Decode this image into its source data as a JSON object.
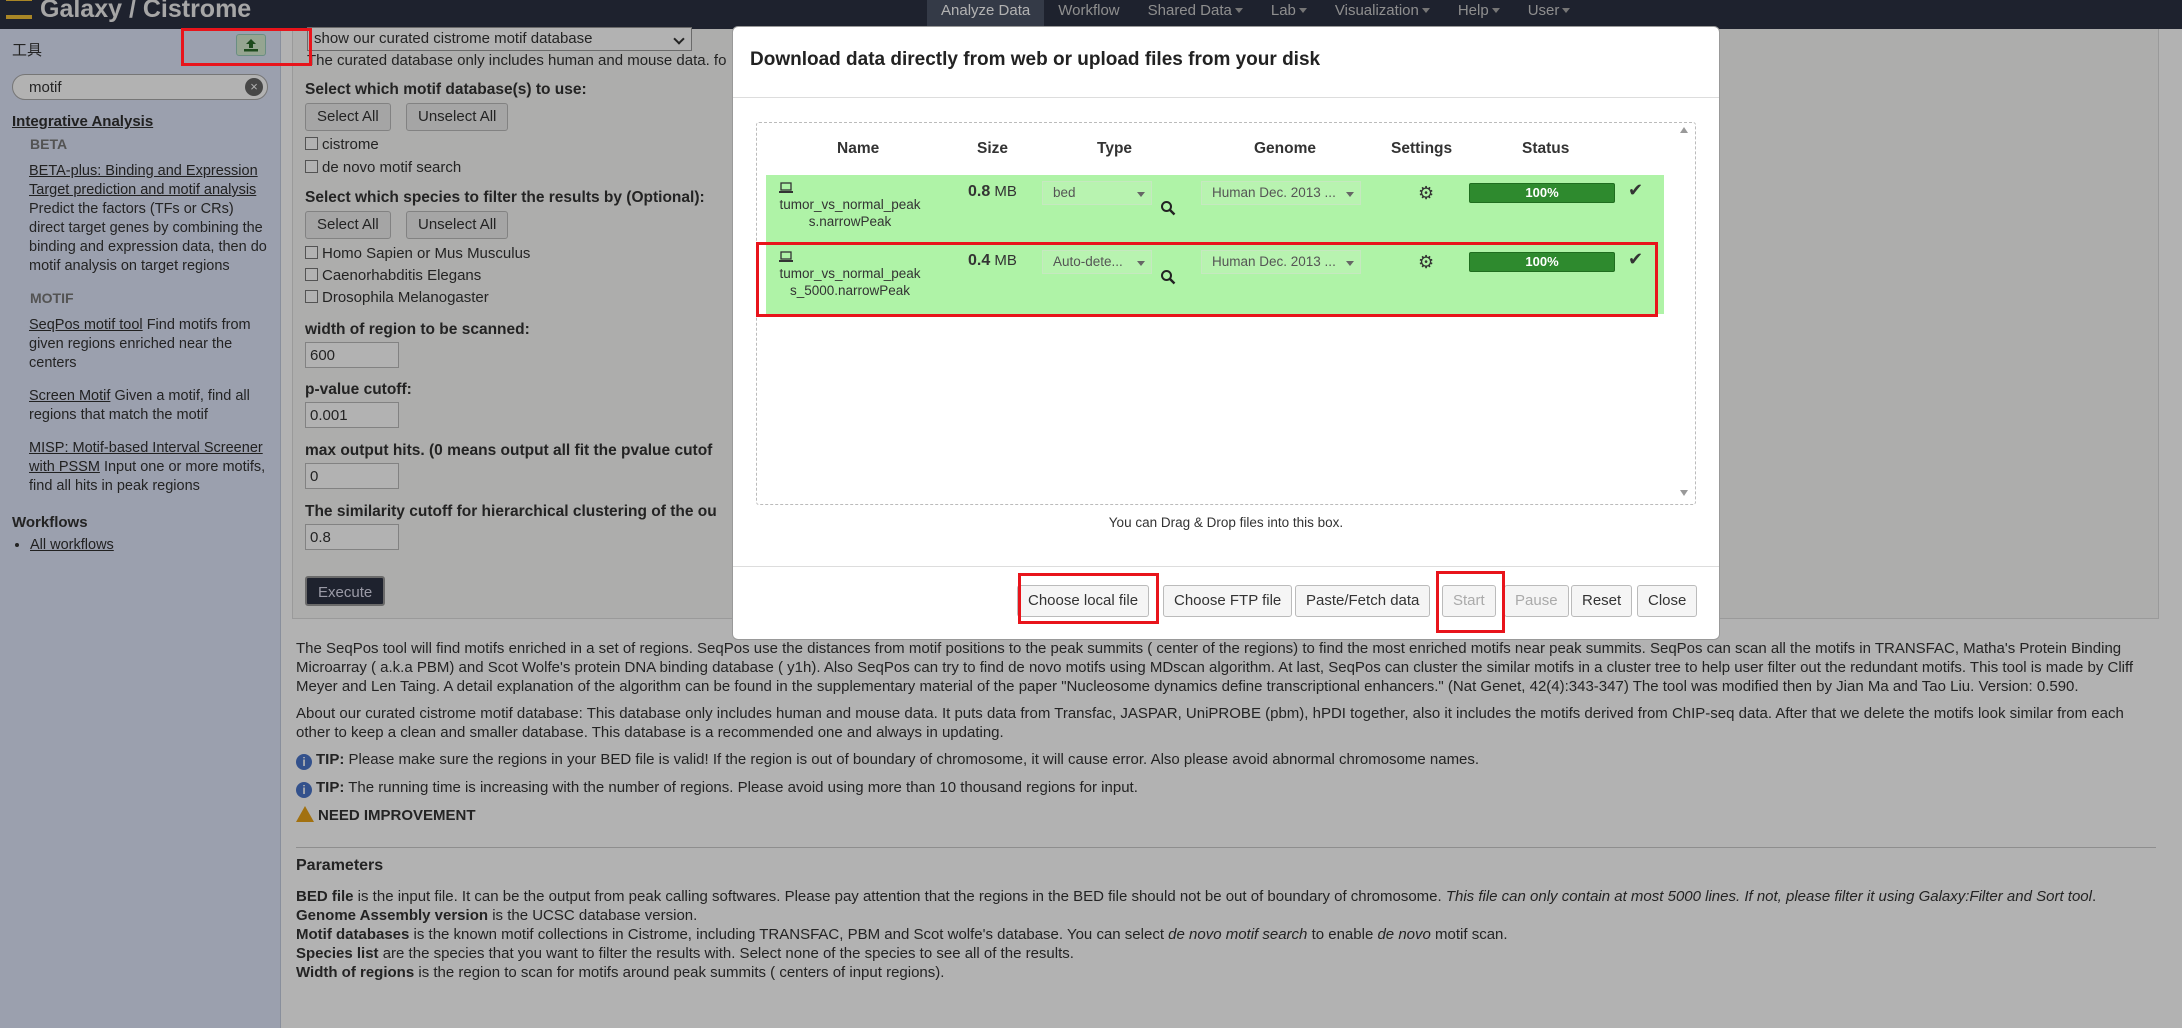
{
  "header": {
    "brand": "Galaxy / Cistrome",
    "nav": [
      {
        "label": "Analyze Data",
        "active": true,
        "dropdown": false
      },
      {
        "label": "Workflow",
        "active": false,
        "dropdown": false
      },
      {
        "label": "Shared Data",
        "active": false,
        "dropdown": true
      },
      {
        "label": "Lab",
        "active": false,
        "dropdown": true
      },
      {
        "label": "Visualization",
        "active": false,
        "dropdown": true
      },
      {
        "label": "Help",
        "active": false,
        "dropdown": true
      },
      {
        "label": "User",
        "active": false,
        "dropdown": true
      }
    ]
  },
  "tools_panel": {
    "title": "工具",
    "upload_icon": "upload-icon",
    "search_value": "motif",
    "section_title": "Integrative Analysis",
    "categories": [
      {
        "name": "BETA",
        "tools": [
          {
            "link": "BETA-plus: Binding and Expression Target prediction and motif analysis",
            "desc": "Predict the factors (TFs or CRs) direct target genes by combining the binding and expression data, then do motif analysis on target regions"
          }
        ]
      },
      {
        "name": "MOTIF",
        "tools": [
          {
            "link": "SeqPos motif tool",
            "desc": "Find motifs from given regions enriched near the centers"
          },
          {
            "link": "Screen Motif",
            "desc": "Given a motif, find all regions that match the motif"
          },
          {
            "link": "MISP: Motif-based Interval Screener with PSSM",
            "desc": "Input one or more motifs, find all hits in peak regions"
          }
        ]
      }
    ],
    "workflows_title": "Workflows",
    "workflows_link": "All workflows"
  },
  "form": {
    "db_select_value": "show our curated cistrome motif database",
    "db_note": "The curated database only includes human and mouse data. fo",
    "db_label": "Select which motif database(s) to use:",
    "select_all": "Select All",
    "unselect_all": "Unselect All",
    "db_options": [
      "cistrome",
      "de novo motif search"
    ],
    "species_label": "Select which species to filter the results by (Optional):",
    "species_options": [
      "Homo Sapien or Mus Musculus",
      "Caenorhabditis Elegans",
      "Drosophila Melanogaster"
    ],
    "width_label": "width of region to be scanned:",
    "width_value": "600",
    "pvalue_label": "p-value cutoff:",
    "pvalue_value": "0.001",
    "maxhits_label": "max output hits. (0 means output all fit the pvalue cutof",
    "maxhits_value": "0",
    "similarity_label": "The similarity cutoff for hierarchical clustering of the ou",
    "similarity_value": "0.8",
    "execute_label": "Execute"
  },
  "help": {
    "para1": "The SeqPos tool will find motifs enriched in a set of regions. SeqPos use the distances from motif positions to the peak summits ( center of the regions) to find the most enriched motifs near peak summits. SeqPos can scan all the motifs in TRANSFAC, Matha's Protein Binding Microarray ( a.k.a PBM) and Scot Wolfe's protein DNA binding database ( y1h). Also SeqPos can try to find de novo motifs using MDscan algorithm. At last, SeqPos can cluster the similar motifs in a cluster tree to help user filter out the redundant motifs. This tool is made by Cliff Meyer and Len Taing. A detail explanation of the algorithm can be found in the supplementary material of the paper \"Nucleosome dynamics define transcriptional enhancers.\" (Nat Genet, 42(4):343-347) The tool was modified then by Jian Ma and Tao Liu. Version: 0.590.",
    "para2": "About our curated cistrome motif database: This database only includes human and mouse data. It puts data from Transfac, JASPAR, UniPROBE (pbm), hPDI together, also it includes the motifs derived from ChIP-seq data. After that we delete the motifs look similar from each other to keep a clean and smaller database. This database is a recommended one and always in updating.",
    "tip_label": "TIP:",
    "tip1": "Please make sure the regions in your BED file is valid! If the region is out of boundary of chromosome, it will cause error. Also please avoid abnormal chromosome names.",
    "tip2": "The running time is increasing with the number of regions. Please avoid using more than 10 thousand regions for input.",
    "need_improvement": "NEED IMPROVEMENT",
    "params_title": "Parameters",
    "p_bed_term": "BED file",
    "p_bed": " is the input file. It can be the output from peak calling softwares. Please pay attention that the regions in the BED file should not be out of boundary of chromosome. ",
    "p_bed_italic": "This file can only contain at most 5000 lines. If not, please filter it using Galaxy:Filter and Sort tool",
    "p_genome_term": "Genome Assembly version",
    "p_genome": " is the UCSC database version.",
    "p_motif_term": "Motif databases",
    "p_motif_a": " is the known motif collections in Cistrome, including TRANSFAC, PBM and Scot wolfe's database. You can select ",
    "p_motif_i1": "de novo motif search",
    "p_motif_b": " to enable ",
    "p_motif_i2": "de novo",
    "p_motif_c": " motif scan.",
    "p_species_term": "Species list",
    "p_species": " are the species that you want to filter the results with. Select none of the species to see all of the results.",
    "p_width_term": "Width of regions",
    "p_width": " is the region to scan for motifs around peak summits ( centers of input regions)."
  },
  "upload_dialog": {
    "title": "Download data directly from web or upload files from your disk",
    "columns": [
      "Name",
      "Size",
      "Type",
      "Genome",
      "Settings",
      "Status"
    ],
    "rows": [
      {
        "name": "tumor_vs_normal_peaks.narrowPeak",
        "size_value": "0.8",
        "size_unit": "MB",
        "type": "bed",
        "genome": "Human Dec. 2013 ...",
        "progress": "100%",
        "progress_fraction": 1.0
      },
      {
        "name": "tumor_vs_normal_peaks_5000.narrowPeak",
        "size_value": "0.4",
        "size_unit": "MB",
        "type": "Auto-dete...",
        "genome": "Human Dec. 2013 ...",
        "progress": "100%",
        "progress_fraction": 1.0
      }
    ],
    "drop_hint": "You can Drag & Drop files into this box.",
    "buttons": {
      "choose_local": "Choose local file",
      "choose_ftp": "Choose FTP file",
      "paste_fetch": "Paste/Fetch data",
      "start": "Start",
      "pause": "Pause",
      "reset": "Reset",
      "close": "Close"
    }
  },
  "annotation_color": "#e8141b"
}
